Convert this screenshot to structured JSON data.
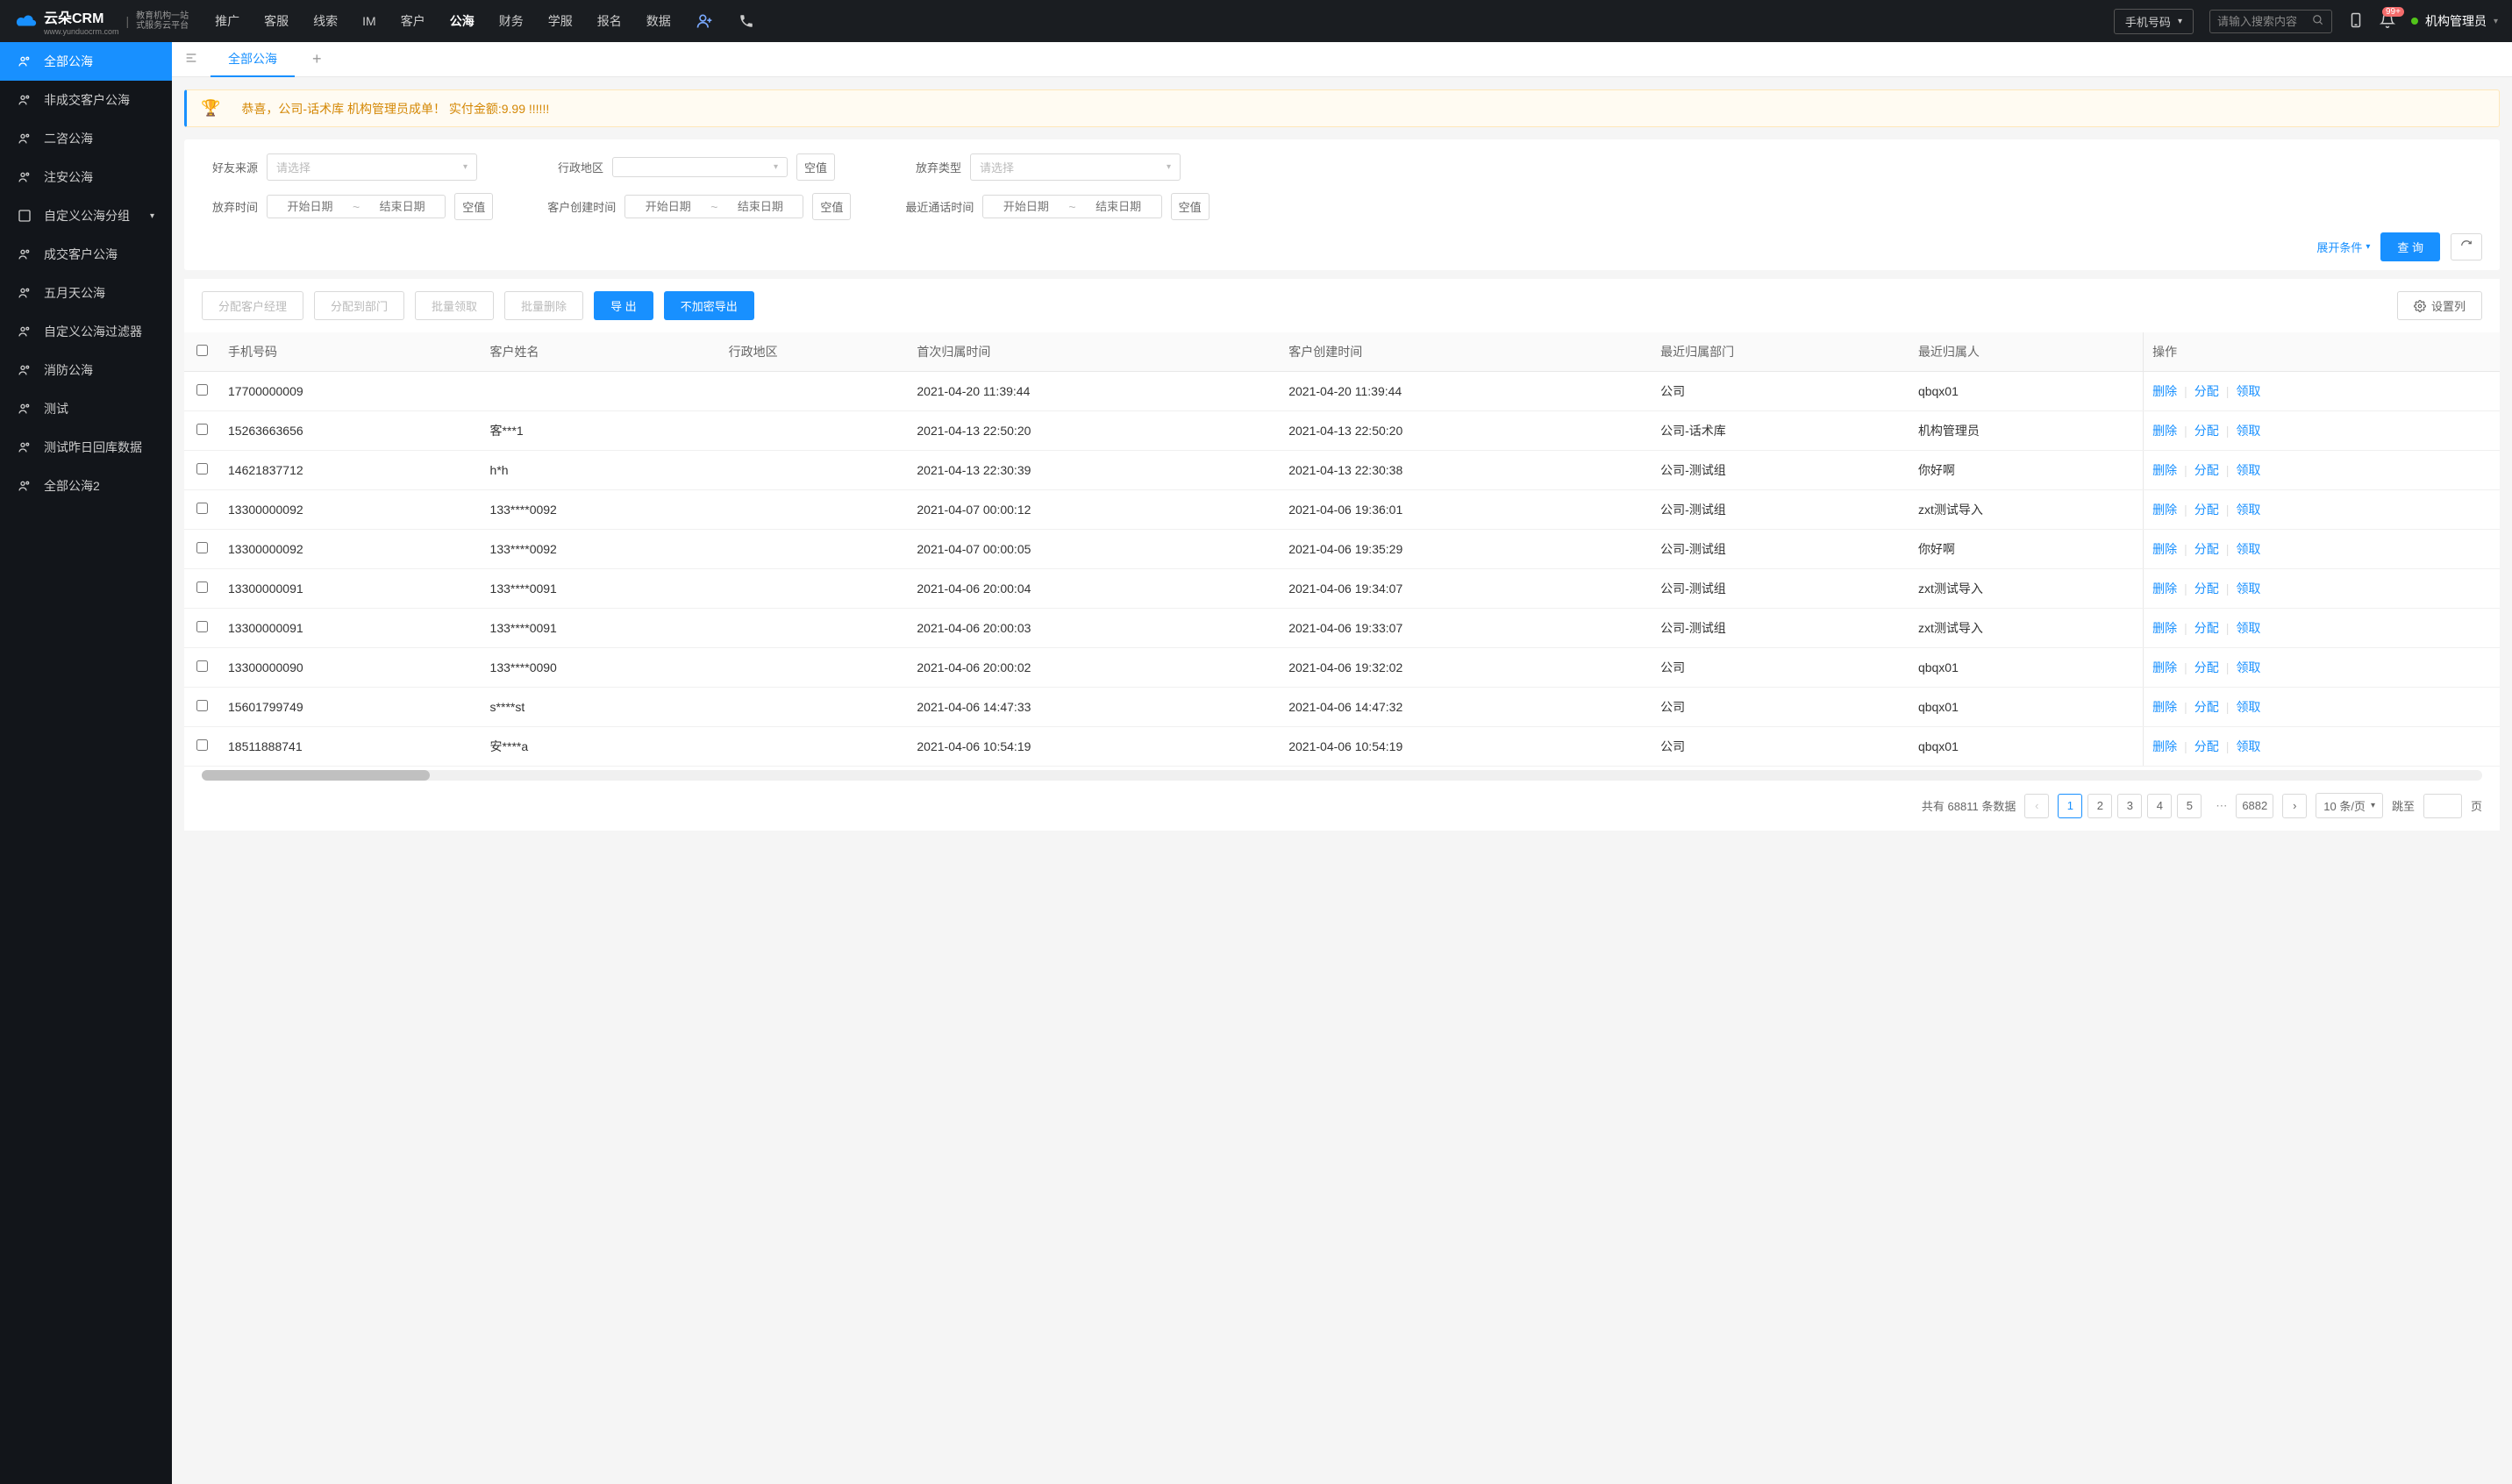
{
  "header": {
    "logo_main": "云朵CRM",
    "logo_url": "www.yunduocrm.com",
    "logo_sub1": "教育机构一站",
    "logo_sub2": "式服务云平台",
    "nav": [
      "推广",
      "客服",
      "线索",
      "IM",
      "客户",
      "公海",
      "财务",
      "学服",
      "报名",
      "数据"
    ],
    "nav_active_index": 5,
    "search_type": "手机号码",
    "search_placeholder": "请输入搜索内容",
    "notification_badge": "99+",
    "user_name": "机构管理员"
  },
  "sidebar": {
    "items": [
      {
        "label": "全部公海",
        "active": true
      },
      {
        "label": "非成交客户公海"
      },
      {
        "label": "二咨公海"
      },
      {
        "label": "注安公海"
      },
      {
        "label": "自定义公海分组",
        "hasChildren": true
      },
      {
        "label": "成交客户公海"
      },
      {
        "label": "五月天公海"
      },
      {
        "label": "自定义公海过滤器"
      },
      {
        "label": "消防公海"
      },
      {
        "label": "测试"
      },
      {
        "label": "测试昨日回库数据"
      },
      {
        "label": "全部公海2"
      }
    ]
  },
  "tabs": {
    "active": "全部公海"
  },
  "announcement": "恭喜，公司-话术库  机构管理员成单！  实付金额:9.99 !!!!!!",
  "filters": {
    "source_label": "好友来源",
    "source_placeholder": "请选择",
    "region_label": "行政地区",
    "abandon_type_label": "放弃类型",
    "abandon_type_placeholder": "请选择",
    "abandon_time_label": "放弃时间",
    "create_time_label": "客户创建时间",
    "last_call_time_label": "最近通话时间",
    "date_start_placeholder": "开始日期",
    "date_end_placeholder": "结束日期",
    "null_btn": "空值",
    "expand_btn": "展开条件",
    "search_btn": "查 询"
  },
  "actions": {
    "assign_manager": "分配客户经理",
    "assign_dept": "分配到部门",
    "batch_claim": "批量领取",
    "batch_delete": "批量删除",
    "export": "导 出",
    "export_plain": "不加密导出",
    "set_columns": "设置列"
  },
  "table": {
    "columns": [
      "手机号码",
      "客户姓名",
      "行政地区",
      "首次归属时间",
      "客户创建时间",
      "最近归属部门",
      "最近归属人",
      "操作"
    ],
    "op_labels": {
      "delete": "删除",
      "assign": "分配",
      "claim": "领取"
    },
    "rows": [
      {
        "phone": "17700000009",
        "name": "",
        "region": "",
        "firstTime": "2021-04-20 11:39:44",
        "createTime": "2021-04-20 11:39:44",
        "dept": "公司",
        "owner": "qbqx01"
      },
      {
        "phone": "15263663656",
        "name": "客***1",
        "region": "",
        "firstTime": "2021-04-13 22:50:20",
        "createTime": "2021-04-13 22:50:20",
        "dept": "公司-话术库",
        "owner": "机构管理员"
      },
      {
        "phone": "14621837712",
        "name": "h*h",
        "region": "",
        "firstTime": "2021-04-13 22:30:39",
        "createTime": "2021-04-13 22:30:38",
        "dept": "公司-测试组",
        "owner": "你好啊"
      },
      {
        "phone": "13300000092",
        "name": "133****0092",
        "region": "",
        "firstTime": "2021-04-07 00:00:12",
        "createTime": "2021-04-06 19:36:01",
        "dept": "公司-测试组",
        "owner": "zxt测试导入"
      },
      {
        "phone": "13300000092",
        "name": "133****0092",
        "region": "",
        "firstTime": "2021-04-07 00:00:05",
        "createTime": "2021-04-06 19:35:29",
        "dept": "公司-测试组",
        "owner": "你好啊"
      },
      {
        "phone": "13300000091",
        "name": "133****0091",
        "region": "",
        "firstTime": "2021-04-06 20:00:04",
        "createTime": "2021-04-06 19:34:07",
        "dept": "公司-测试组",
        "owner": "zxt测试导入"
      },
      {
        "phone": "13300000091",
        "name": "133****0091",
        "region": "",
        "firstTime": "2021-04-06 20:00:03",
        "createTime": "2021-04-06 19:33:07",
        "dept": "公司-测试组",
        "owner": "zxt测试导入"
      },
      {
        "phone": "13300000090",
        "name": "133****0090",
        "region": "",
        "firstTime": "2021-04-06 20:00:02",
        "createTime": "2021-04-06 19:32:02",
        "dept": "公司",
        "owner": "qbqx01"
      },
      {
        "phone": "15601799749",
        "name": "s****st",
        "region": "",
        "firstTime": "2021-04-06 14:47:33",
        "createTime": "2021-04-06 14:47:32",
        "dept": "公司",
        "owner": "qbqx01"
      },
      {
        "phone": "18511888741",
        "name": "安****a",
        "region": "",
        "firstTime": "2021-04-06 10:54:19",
        "createTime": "2021-04-06 10:54:19",
        "dept": "公司",
        "owner": "qbqx01"
      }
    ]
  },
  "pagination": {
    "total_prefix": "共有",
    "total": "68811",
    "total_suffix": "条数据",
    "pages": [
      "1",
      "2",
      "3",
      "4",
      "5"
    ],
    "last_page": "6882",
    "per_page": "10 条/页",
    "jump_label": "跳至",
    "page_unit": "页"
  }
}
